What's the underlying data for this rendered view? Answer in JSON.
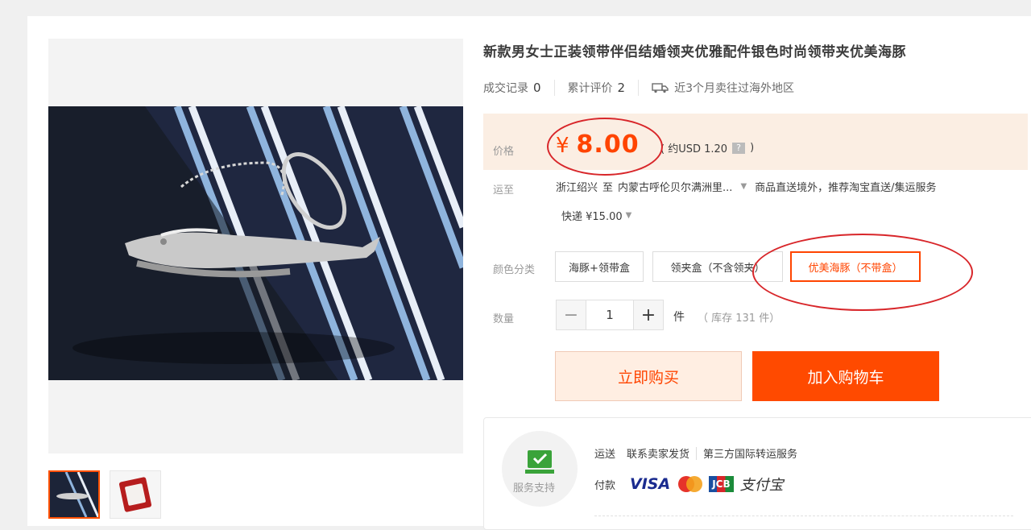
{
  "product": {
    "title": "新款男女士正装领带伴侣结婚领夹优雅配件银色时尚领带夹优美海豚"
  },
  "meta": {
    "deals_label": "成交记录",
    "deals_count": "0",
    "reviews_label": "累计评价",
    "reviews_count": "2",
    "overseas_text": "近3个月卖往过海外地区"
  },
  "price": {
    "label": "价格",
    "currency_symbol": "¥",
    "value": "8.00",
    "usd_text": "( 约USD 1.20",
    "usd_close": ")",
    "help_icon": "?"
  },
  "shipping": {
    "label": "运至",
    "from": "浙江绍兴",
    "to_word": "至",
    "destination": "内蒙古呼伦贝尔满洲里...",
    "note": "商品直送境外，推荐淘宝直送/集运服务",
    "fee": "快递 ¥15.00"
  },
  "sku": {
    "label": "颜色分类",
    "options": [
      "海豚+领带盒",
      "领夹盒（不含领夹）",
      "优美海豚（不带盒）"
    ],
    "selected_index": 2
  },
  "quantity": {
    "label": "数量",
    "minus": "−",
    "value": "1",
    "plus": "+",
    "unit": "件",
    "stock": "（ 库存 131 件）"
  },
  "actions": {
    "buy_now": "立即购买",
    "add_to_cart": "加入购物车"
  },
  "service": {
    "label": "服务支持",
    "ship_label": "运送",
    "ship_seller": "联系卖家发货",
    "ship_third": "第三方国际转运服务",
    "pay_label": "付款",
    "visa": "VISA",
    "jcb": "JCB",
    "alipay": "支付宝"
  },
  "colors": {
    "accent": "#ff4400",
    "cart_button": "#ff4a00",
    "price_band": "#fbeee3",
    "annotation": "#d8262a"
  },
  "icons": [
    "truck-icon",
    "help-icon",
    "dropdown-caret-icon",
    "service-icon",
    "visa-logo",
    "mastercard-logo",
    "jcb-logo",
    "alipay-logo"
  ]
}
